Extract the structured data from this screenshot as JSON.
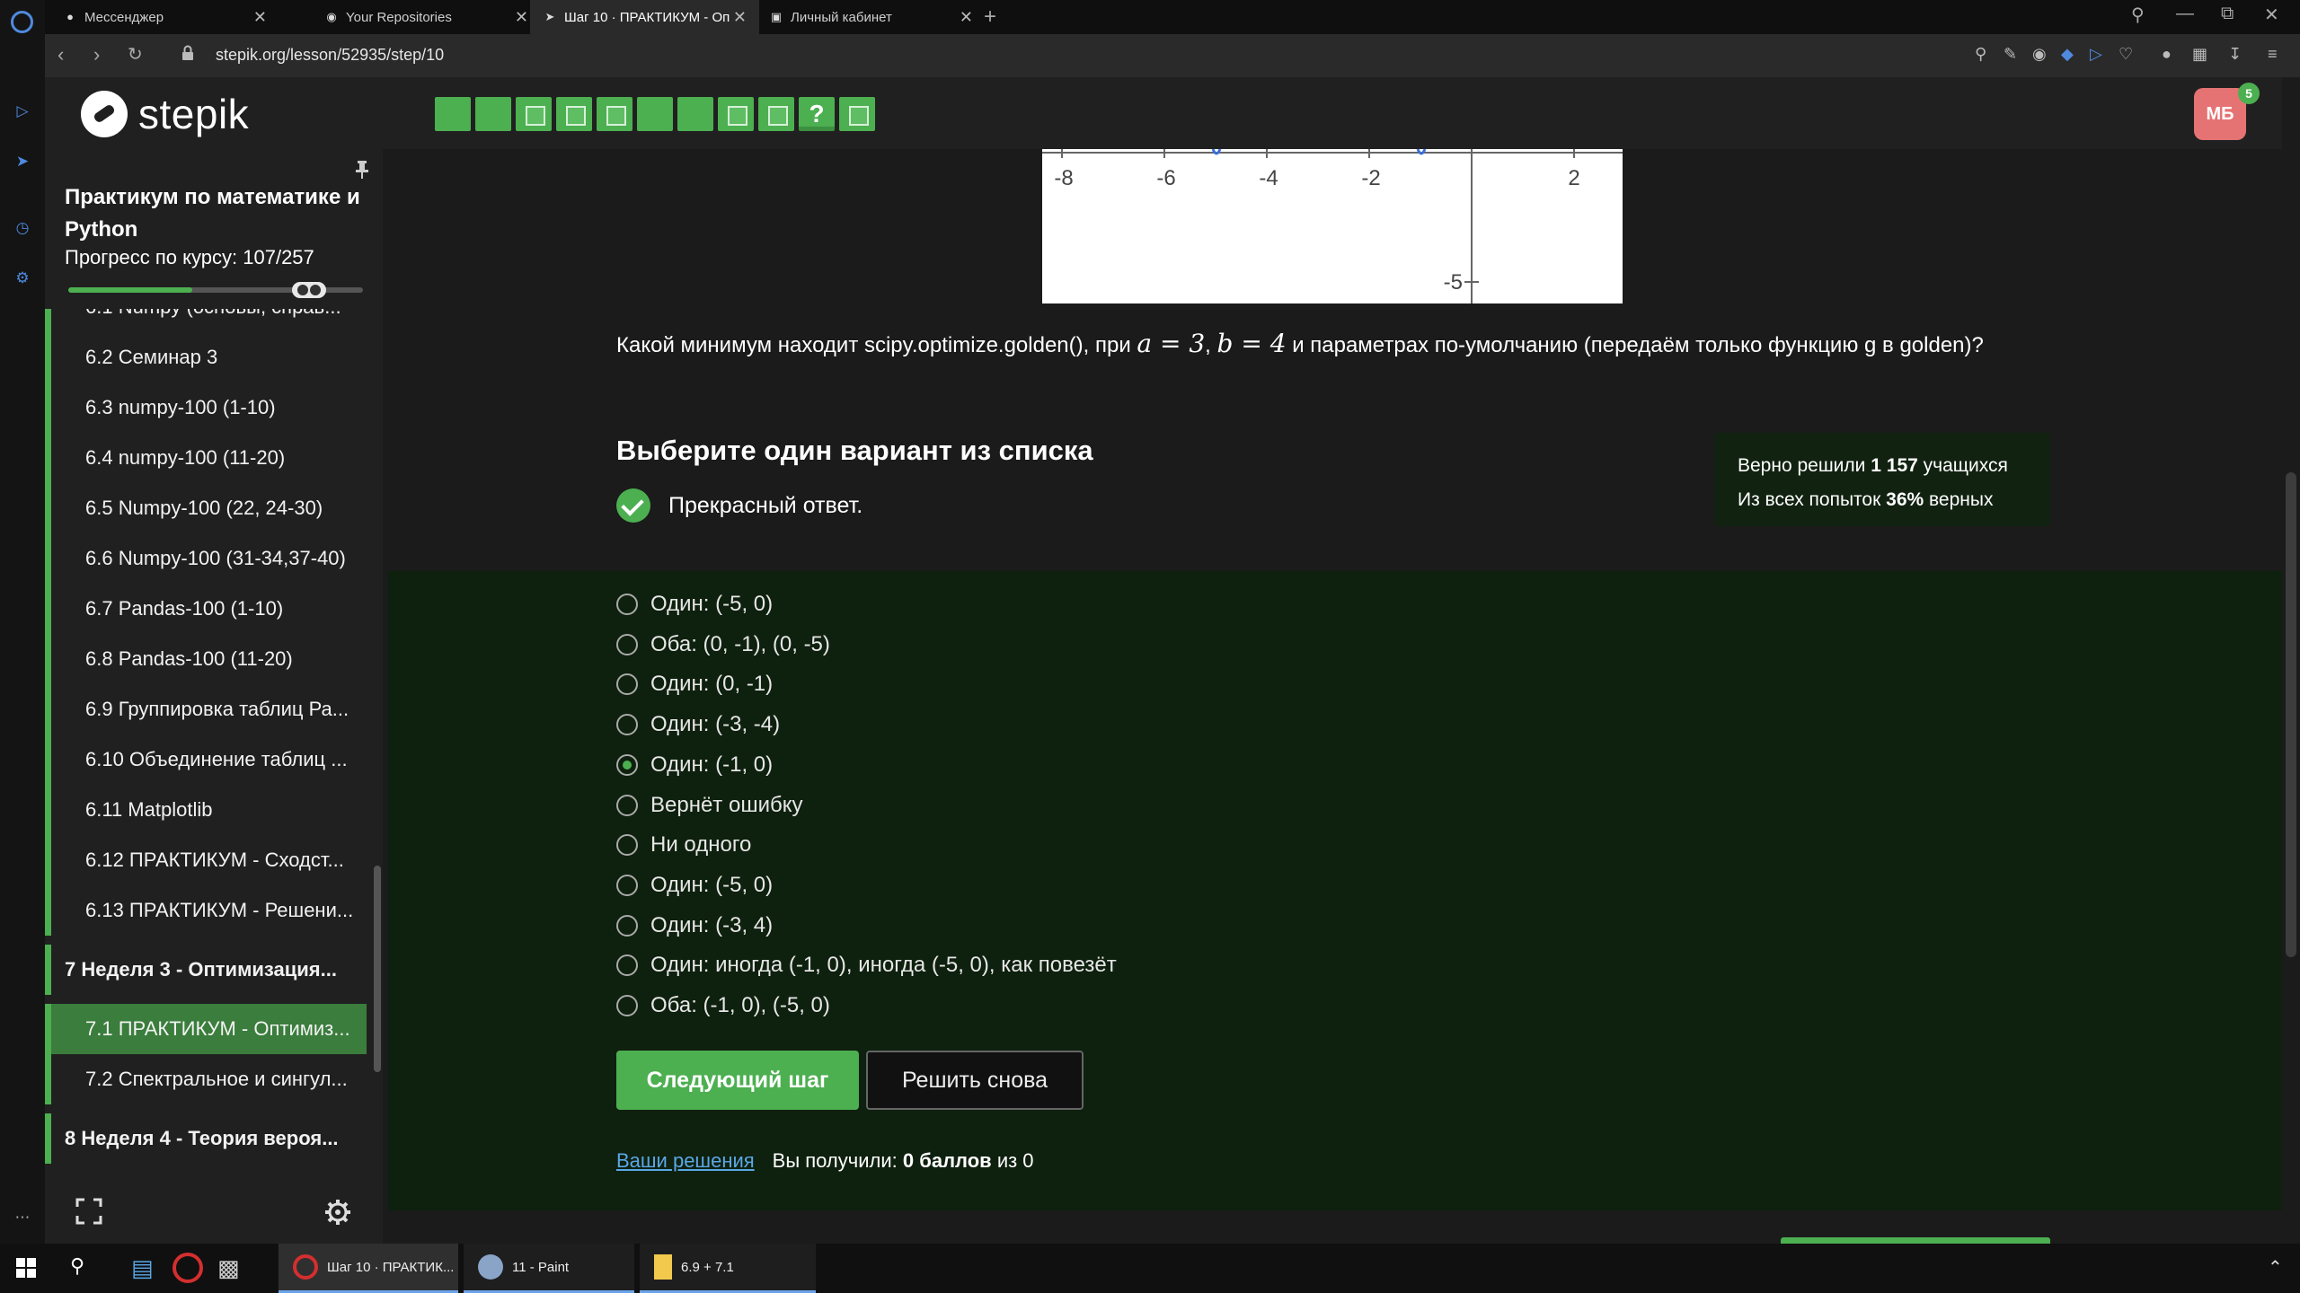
{
  "browser": {
    "tabs": [
      {
        "label": "Мессенджер",
        "active": false
      },
      {
        "label": "Your Repositories",
        "active": false
      },
      {
        "label": "Шаг 10 · ПРАКТИКУМ - Оп",
        "active": true
      },
      {
        "label": "Личный кабинет",
        "active": false
      }
    ],
    "url": "stepik.org/lesson/52935/step/10"
  },
  "header": {
    "logo": "stepik",
    "step_quiz_label": "?",
    "avatar_initials": "МБ",
    "notifications": "5"
  },
  "sidebar": {
    "course_title": "Практикум по математике и Python",
    "progress_label": "Прогресс по курсу:",
    "progress_value": "107/257",
    "progress_fraction": 0.42,
    "items": [
      {
        "label": "6.1  Numpy (основы, справ...",
        "type": "lesson"
      },
      {
        "label": "6.2  Семинар 3",
        "type": "lesson"
      },
      {
        "label": "6.3  numpy-100 (1-10)",
        "type": "lesson"
      },
      {
        "label": "6.4  numpy-100 (11-20)",
        "type": "lesson"
      },
      {
        "label": "6.5  Numpy-100 (22, 24-30)",
        "type": "lesson"
      },
      {
        "label": "6.6  Numpy-100 (31-34,37-40)",
        "type": "lesson"
      },
      {
        "label": "6.7  Pandas-100 (1-10)",
        "type": "lesson"
      },
      {
        "label": "6.8  Pandas-100 (11-20)",
        "type": "lesson"
      },
      {
        "label": "6.9  Группировка таблиц Ра...",
        "type": "lesson"
      },
      {
        "label": "6.10  Объединение таблиц ...",
        "type": "lesson"
      },
      {
        "label": "6.11  Matplotlib",
        "type": "lesson"
      },
      {
        "label": "6.12  ПРАКТИКУМ - Сходст...",
        "type": "lesson"
      },
      {
        "label": "6.13  ПРАКТИКУМ - Решени...",
        "type": "lesson"
      },
      {
        "label": "7  Неделя 3 - Оптимизация...",
        "type": "module"
      },
      {
        "label": "7.1  ПРАКТИКУМ - Оптимиз...",
        "type": "lesson",
        "active": true
      },
      {
        "label": "7.2  Спектральное и сингул...",
        "type": "lesson"
      },
      {
        "label": "8  Неделя 4 - Теория вероя...",
        "type": "module"
      }
    ]
  },
  "plot": {
    "x_ticks": [
      "-8",
      "-6",
      "-4",
      "-2",
      "2"
    ],
    "y_ticks": [
      "-5"
    ]
  },
  "main": {
    "question_prefix": "Какой минимум находит scipy.optimize.golden(), при",
    "math_a": "a = 3",
    "math_sep": ",",
    "math_b": "b = 4",
    "question_suffix": "и параметрах по-умолчанию (передаём только функцию g в golden)?",
    "section_title": "Выберите один вариант из списка",
    "feedback": "Прекрасный ответ.",
    "stats_line1_prefix": "Верно решили",
    "stats_line1_value": "1 157",
    "stats_line1_suffix": "учащихся",
    "stats_line2_prefix": "Из всех попыток",
    "stats_line2_value": "36%",
    "stats_line2_suffix": "верных",
    "options": [
      {
        "label": "Один: (-5, 0)",
        "checked": false
      },
      {
        "label": "Оба: (0, -1), (0, -5)",
        "checked": false
      },
      {
        "label": "Один: (0, -1)",
        "checked": false
      },
      {
        "label": "Один: (-3, -4)",
        "checked": false
      },
      {
        "label": "Один: (-1, 0)",
        "checked": true
      },
      {
        "label": "Вернёт ошибку",
        "checked": false
      },
      {
        "label": "Ни одного",
        "checked": false
      },
      {
        "label": "Один: (-5, 0)",
        "checked": false
      },
      {
        "label": "Один: (-3, 4)",
        "checked": false
      },
      {
        "label": "Один: иногда (-1, 0), иногда (-5, 0), как повезёт",
        "checked": false
      },
      {
        "label": "Оба: (-1, 0), (-5, 0)",
        "checked": false
      }
    ],
    "next_button": "Следующий шаг",
    "retry_button": "Решить снова",
    "solutions_link": "Ваши решения",
    "score_prefix": "Вы получили:",
    "score_value": "0 баллов",
    "score_suffix": "из 0"
  },
  "taskbar": {
    "items": [
      {
        "label": "Шаг 10 · ПРАКТИК...",
        "active": true
      },
      {
        "label": "11 - Paint",
        "active": false
      },
      {
        "label": "6.9 + 7.1",
        "active": false
      }
    ]
  },
  "colors": {
    "accent_green": "#4caf50",
    "link_blue": "#5aa7e6",
    "avatar_red": "#e57373",
    "answer_bg": "#0e200e"
  }
}
